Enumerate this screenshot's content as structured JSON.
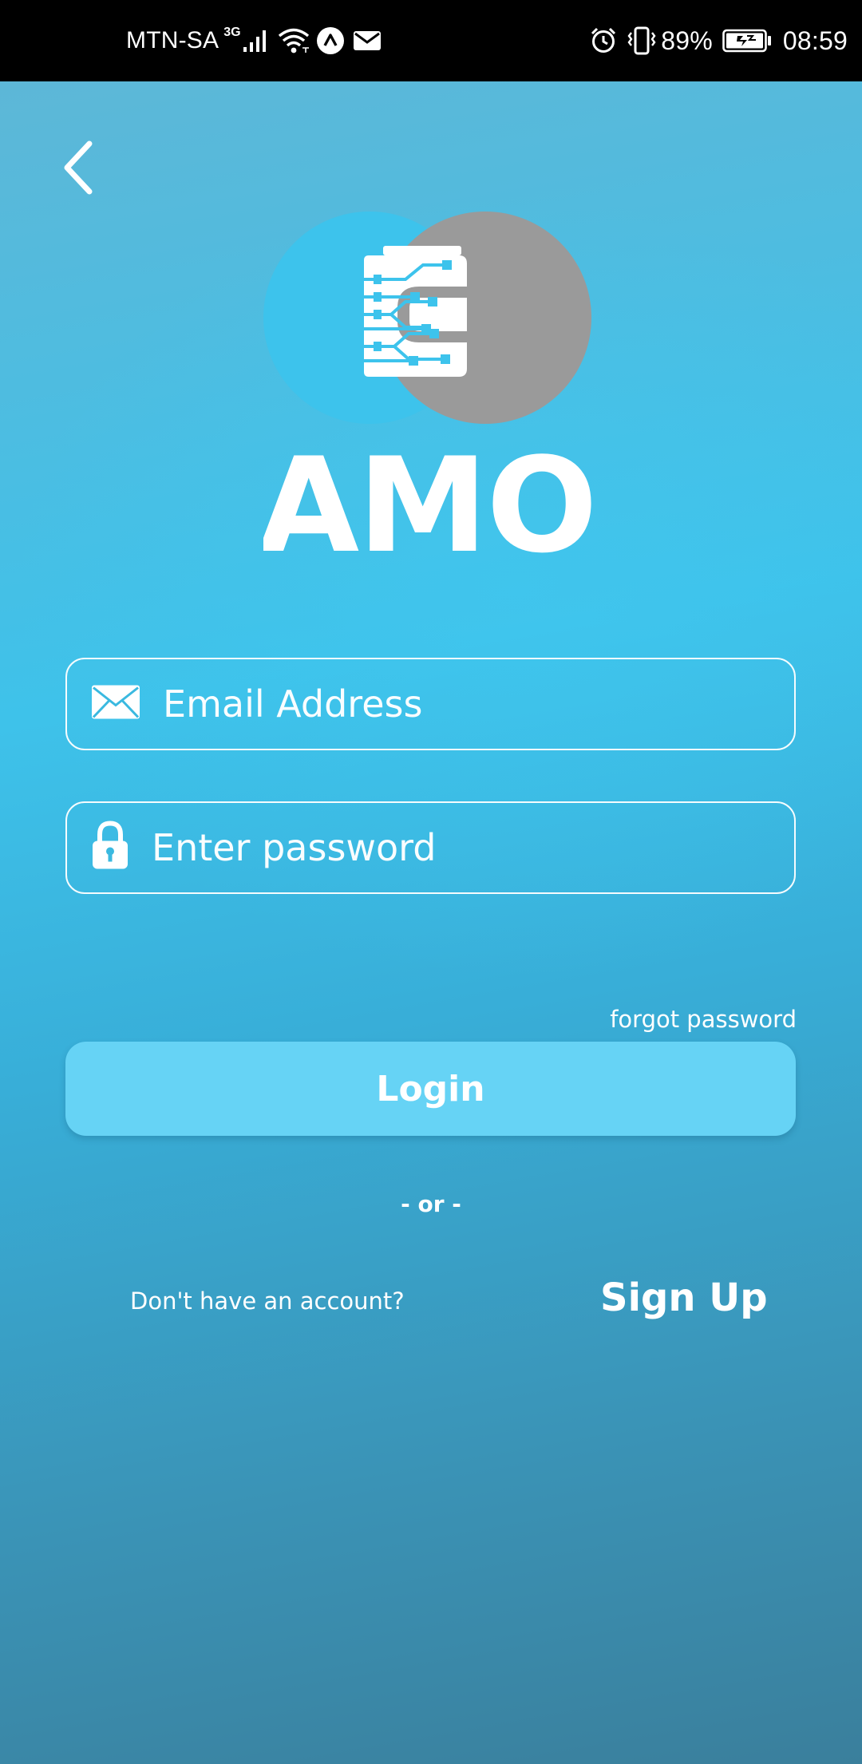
{
  "status_bar": {
    "carrier": "MTN-SA",
    "network_type": "3G",
    "battery_percent": "89%",
    "time": "08:59",
    "icons": [
      "signal-icon",
      "wifi-icon",
      "app-notification-icon",
      "mail-icon",
      "alarm-icon",
      "vibrate-icon",
      "battery-charging-icon"
    ]
  },
  "header": {
    "back_icon": "chevron-left-icon"
  },
  "logo": {
    "text": "AMO",
    "colors": {
      "circle_left": "#3dc3ec",
      "circle_right": "#9a9a9a",
      "circuit": "#3dc3ec"
    }
  },
  "form": {
    "email": {
      "placeholder": "Email Address",
      "value": "",
      "icon": "envelope-icon"
    },
    "password": {
      "placeholder": "Enter password",
      "value": "",
      "icon": "lock-icon"
    },
    "forgot_label": "forgot password",
    "login_label": "Login"
  },
  "divider_label": "- or -",
  "signup": {
    "prompt": "Don't have an account?",
    "label": "Sign Up"
  },
  "colors": {
    "background_top": "#5db7d7",
    "background_mid": "#3ec2ea",
    "background_bottom": "#3a7f9c",
    "button": "#66d3f5",
    "text": "#ffffff"
  }
}
